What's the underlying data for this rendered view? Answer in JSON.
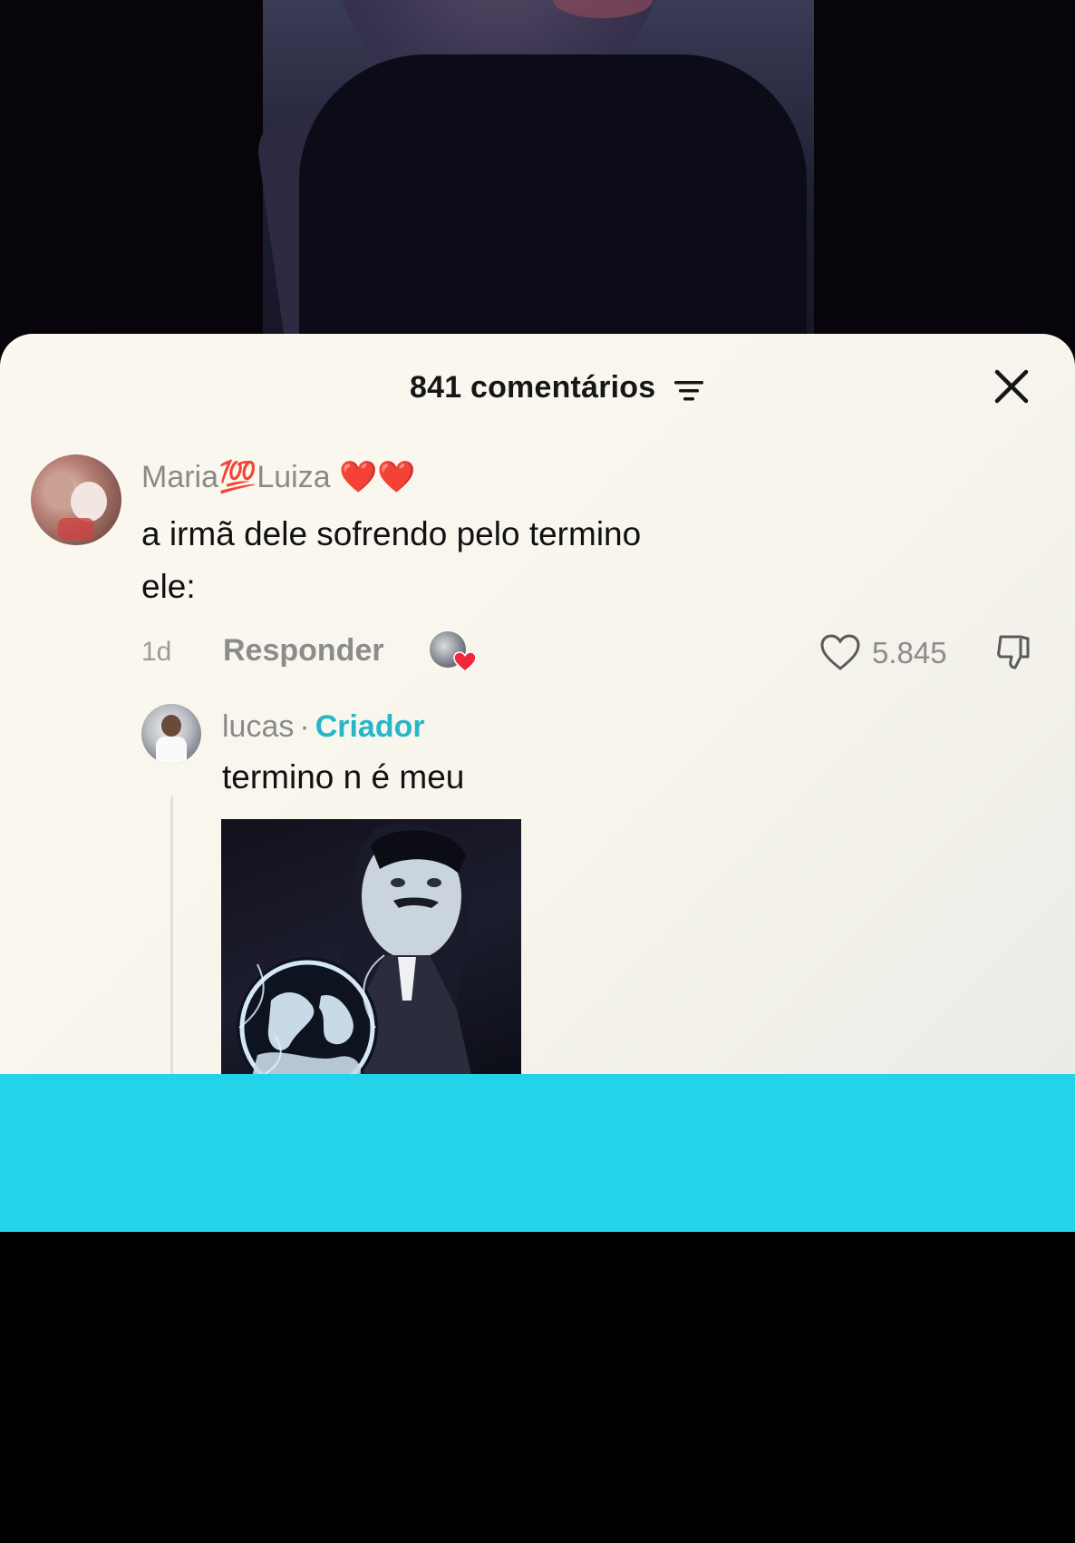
{
  "comments_panel": {
    "count_label": "841 comentários",
    "close_icon": "close-icon",
    "filter_icon": "filter-icon"
  },
  "comment": {
    "author": "Maria💯Luiza",
    "author_emoji": "❤️❤️",
    "text": "a irmã dele sofrendo pelo termino\nele:",
    "time": "1d",
    "reply_label": "Responder",
    "like_count": "5.845"
  },
  "reply": {
    "author": "lucas",
    "separator": "·",
    "badge": "Criador",
    "text": "termino n é meu"
  },
  "colors": {
    "accent_cyan": "#22d3e9",
    "creator_badge": "#27b6c8",
    "heart_red": "#e0202c"
  }
}
